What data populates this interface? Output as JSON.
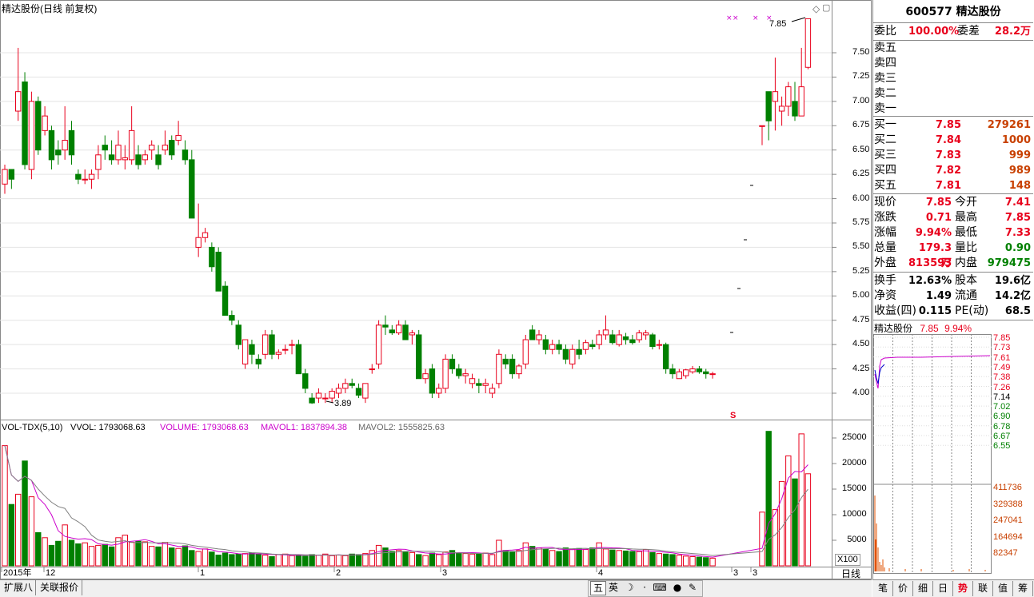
{
  "chart": {
    "title": "精达股份(日线 前复权)",
    "price_ticks": [
      "7.50",
      "7.25",
      "7.00",
      "6.75",
      "6.50",
      "6.25",
      "6.00",
      "5.75",
      "5.50",
      "5.25",
      "5.00",
      "4.75",
      "4.50",
      "4.25",
      "4.00"
    ],
    "high_label": "7.85",
    "low_label": "3.89",
    "s_marker": "S",
    "vol_title": "VOL-TDX(5,10)",
    "vvol": "VVOL: 1793068.63",
    "volume": "VOLUME: 1793068.63",
    "mavol1": "MAVOL1: 1837894.38",
    "mavol2": "MAVOL2: 1555825.63",
    "vol_ticks": [
      "25000",
      "20000",
      "15000",
      "10000",
      "5000"
    ],
    "vol_unit": "X100",
    "period_label": "日线",
    "x_labels": [
      "2015年",
      "12",
      "1",
      "2",
      "3",
      "3",
      "4",
      "3",
      "3"
    ],
    "colors": {
      "up": "#e8001c",
      "down": "#008000",
      "ma1": "#cc00cc",
      "ma2": "#808080"
    }
  },
  "chart_data": {
    "type": "candlestick",
    "title": "精达股份(日线 前复权)",
    "ylim": [
      3.8,
      7.95
    ],
    "volume_ylim": [
      0,
      27000
    ],
    "candles": [
      [
        6.15,
        6.35,
        6.05,
        6.3
      ],
      [
        6.3,
        6.3,
        6.1,
        6.2
      ],
      [
        6.9,
        7.55,
        6.8,
        7.1
      ],
      [
        7.2,
        7.3,
        6.3,
        6.35
      ],
      [
        6.3,
        7.1,
        6.2,
        7.0
      ],
      [
        7.0,
        7.05,
        6.45,
        6.5
      ],
      [
        6.7,
        6.95,
        6.65,
        6.85
      ],
      [
        6.7,
        6.75,
        6.3,
        6.4
      ],
      [
        6.5,
        6.6,
        6.35,
        6.45
      ],
      [
        6.5,
        6.95,
        6.4,
        6.6
      ],
      [
        6.7,
        6.8,
        6.35,
        6.45
      ],
      [
        6.25,
        6.3,
        6.15,
        6.2
      ],
      [
        6.2,
        6.3,
        6.15,
        6.2
      ],
      [
        6.2,
        6.3,
        6.1,
        6.25
      ],
      [
        6.3,
        6.55,
        6.2,
        6.45
      ],
      [
        6.55,
        6.65,
        6.4,
        6.5
      ],
      [
        6.45,
        6.6,
        6.35,
        6.4
      ],
      [
        6.4,
        6.7,
        6.35,
        6.55
      ],
      [
        6.4,
        6.55,
        6.3,
        6.42
      ],
      [
        6.4,
        6.95,
        6.35,
        6.7
      ],
      [
        6.45,
        6.55,
        6.3,
        6.35
      ],
      [
        6.4,
        6.5,
        6.35,
        6.45
      ],
      [
        6.5,
        6.6,
        6.4,
        6.55
      ],
      [
        6.45,
        6.55,
        6.3,
        6.35
      ],
      [
        6.5,
        6.7,
        6.45,
        6.55
      ],
      [
        6.6,
        6.65,
        6.4,
        6.45
      ],
      [
        6.6,
        6.8,
        6.55,
        6.65
      ],
      [
        6.5,
        6.6,
        6.35,
        6.4
      ],
      [
        6.4,
        6.5,
        5.85,
        5.8
      ],
      [
        5.5,
        5.95,
        5.4,
        5.6
      ],
      [
        5.6,
        5.7,
        5.55,
        5.65
      ],
      [
        5.5,
        5.55,
        5.25,
        5.3
      ],
      [
        5.45,
        5.5,
        5.05,
        5.05
      ],
      [
        5.1,
        5.15,
        4.85,
        4.8
      ],
      [
        4.8,
        4.85,
        4.7,
        4.75
      ],
      [
        4.7,
        4.75,
        4.45,
        4.5
      ],
      [
        4.3,
        4.55,
        4.25,
        4.55
      ],
      [
        4.5,
        4.55,
        4.3,
        4.4
      ],
      [
        4.35,
        4.4,
        4.25,
        4.3
      ],
      [
        4.4,
        4.65,
        4.35,
        4.6
      ],
      [
        4.6,
        4.65,
        4.35,
        4.4
      ],
      [
        4.4,
        4.45,
        4.35,
        4.42
      ],
      [
        4.45,
        4.5,
        4.4,
        4.45
      ],
      [
        4.5,
        4.55,
        4.4,
        4.5
      ],
      [
        4.5,
        4.55,
        4.2,
        4.2
      ],
      [
        4.2,
        4.25,
        4.0,
        4.05
      ],
      [
        3.95,
        4.0,
        3.89,
        3.9
      ],
      [
        3.95,
        4.05,
        3.9,
        4.0
      ],
      [
        3.95,
        4.0,
        3.9,
        3.95
      ],
      [
        3.95,
        4.05,
        3.9,
        4.02
      ],
      [
        4.0,
        4.1,
        3.95,
        4.05
      ],
      [
        4.05,
        4.15,
        4.0,
        4.1
      ],
      [
        4.1,
        4.15,
        4.05,
        4.08
      ],
      [
        4.05,
        4.1,
        3.95,
        3.98
      ],
      [
        3.95,
        4.1,
        3.9,
        4.1
      ],
      [
        4.25,
        4.3,
        4.2,
        4.25
      ],
      [
        4.3,
        4.75,
        4.25,
        4.7
      ],
      [
        4.7,
        4.8,
        4.6,
        4.68
      ],
      [
        4.65,
        4.7,
        4.6,
        4.62
      ],
      [
        4.62,
        4.75,
        4.6,
        4.7
      ],
      [
        4.7,
        4.75,
        4.55,
        4.55
      ],
      [
        4.6,
        4.65,
        4.5,
        4.62
      ],
      [
        4.6,
        4.65,
        4.15,
        4.15
      ],
      [
        4.15,
        4.25,
        4.1,
        4.2
      ],
      [
        4.25,
        4.3,
        3.95,
        4.0
      ],
      [
        4.0,
        4.1,
        3.95,
        4.05
      ],
      [
        4.05,
        4.4,
        4.0,
        4.35
      ],
      [
        4.35,
        4.4,
        4.2,
        4.25
      ],
      [
        4.25,
        4.3,
        4.15,
        4.18
      ],
      [
        4.18,
        4.25,
        4.1,
        4.2
      ],
      [
        4.1,
        4.2,
        4.05,
        4.15
      ],
      [
        4.1,
        4.15,
        4.0,
        4.08
      ],
      [
        4.08,
        4.15,
        4.0,
        4.1
      ],
      [
        4.0,
        4.1,
        3.95,
        4.05
      ],
      [
        4.1,
        4.45,
        4.05,
        4.4
      ],
      [
        4.35,
        4.4,
        4.25,
        4.3
      ],
      [
        4.35,
        4.4,
        4.15,
        4.2
      ],
      [
        4.2,
        4.3,
        4.15,
        4.28
      ],
      [
        4.3,
        4.6,
        4.25,
        4.55
      ],
      [
        4.65,
        4.7,
        4.55,
        4.55
      ],
      [
        4.55,
        4.65,
        4.5,
        4.6
      ],
      [
        4.55,
        4.6,
        4.4,
        4.45
      ],
      [
        4.45,
        4.55,
        4.4,
        4.5
      ],
      [
        4.5,
        4.55,
        4.4,
        4.45
      ],
      [
        4.45,
        4.5,
        4.3,
        4.35
      ],
      [
        4.3,
        4.5,
        4.25,
        4.45
      ],
      [
        4.45,
        4.55,
        4.35,
        4.4
      ],
      [
        4.45,
        4.55,
        4.4,
        4.52
      ],
      [
        4.5,
        4.55,
        4.45,
        4.48
      ],
      [
        4.5,
        4.65,
        4.45,
        4.6
      ],
      [
        4.6,
        4.8,
        4.55,
        4.65
      ],
      [
        4.6,
        4.65,
        4.5,
        4.52
      ],
      [
        4.5,
        4.65,
        4.48,
        4.6
      ],
      [
        4.58,
        4.62,
        4.5,
        4.55
      ],
      [
        4.55,
        4.6,
        4.5,
        4.52
      ],
      [
        4.55,
        4.65,
        4.52,
        4.62
      ],
      [
        4.6,
        4.65,
        4.55,
        4.62
      ],
      [
        4.6,
        4.62,
        4.45,
        4.48
      ],
      [
        4.5,
        4.55,
        4.45,
        4.5
      ],
      [
        4.5,
        4.52,
        4.2,
        4.25
      ],
      [
        4.25,
        4.3,
        4.15,
        4.2
      ],
      [
        4.15,
        4.25,
        4.15,
        4.22
      ],
      [
        4.18,
        4.25,
        4.15,
        4.24
      ],
      [
        4.22,
        4.28,
        4.2,
        4.25
      ],
      [
        4.25,
        4.28,
        4.2,
        4.22
      ],
      [
        4.22,
        4.25,
        4.15,
        4.2
      ],
      [
        4.2,
        4.22,
        4.15,
        4.2
      ],
      [
        6.75,
        6.75,
        6.55,
        6.75
      ],
      [
        7.1,
        7.1,
        6.6,
        6.8
      ],
      [
        7.0,
        7.45,
        6.7,
        7.1
      ],
      [
        6.9,
        7.05,
        6.75,
        6.95
      ],
      [
        6.95,
        7.2,
        6.85,
        7.15
      ],
      [
        7.0,
        7.2,
        6.8,
        6.85
      ],
      [
        6.85,
        7.55,
        6.85,
        7.15
      ],
      [
        7.35,
        7.85,
        7.33,
        7.85
      ]
    ],
    "volumes": [
      23500,
      12000,
      14000,
      20500,
      13500,
      6500,
      5500,
      4000,
      4800,
      8000,
      5000,
      4300,
      4500,
      3800,
      4000,
      4200,
      3700,
      5500,
      6000,
      4600,
      4800,
      4700,
      3800,
      3700,
      4600,
      3500,
      3400,
      3900,
      3000,
      2800,
      3300,
      2700,
      2100,
      2500,
      2200,
      2300,
      2400,
      2500,
      2300,
      2100,
      1800,
      2200,
      2300,
      2000,
      2100,
      1900,
      2200,
      2100,
      2300,
      2000,
      2100,
      2000,
      2300,
      2200,
      2400,
      3000,
      4000,
      3500,
      2800,
      3000,
      2800,
      2600,
      2200,
      2000,
      2500,
      2200,
      2700,
      3000,
      2500,
      2400,
      2300,
      2400,
      2500,
      2200,
      5000,
      3000,
      2800,
      3000,
      4500,
      3800,
      3500,
      3200,
      3000,
      2800,
      3500,
      3300,
      3400,
      3200,
      3500,
      4500,
      3300,
      3100,
      3000,
      2900,
      2800,
      2800,
      3200,
      2600,
      2400,
      2300,
      2200,
      2100,
      1900,
      1800,
      1700,
      1600,
      1500,
      10500,
      26300,
      11000,
      16500,
      21500,
      17000,
      25800,
      18000
    ],
    "ma5_label": "MAVOL1: 1837894.38",
    "ma10_label": "MAVOL2: 1555825.63"
  },
  "quote": {
    "code_name": "600577  精达股份",
    "weibi_label": "委比",
    "weibi_value": "100.00%",
    "weicha_label": "委差",
    "weicha_value": "28.2万",
    "sells": [
      "卖五",
      "卖四",
      "卖三",
      "卖二",
      "卖一"
    ],
    "buys": [
      {
        "label": "买一",
        "price": "7.85",
        "vol": "279261"
      },
      {
        "label": "买二",
        "price": "7.84",
        "vol": "1000"
      },
      {
        "label": "买三",
        "price": "7.83",
        "vol": "999"
      },
      {
        "label": "买四",
        "price": "7.82",
        "vol": "989"
      },
      {
        "label": "买五",
        "price": "7.81",
        "vol": "148"
      }
    ],
    "stats": [
      {
        "l1": "现价",
        "v1": "7.85",
        "l2": "今开",
        "v2": "7.41",
        "c1": "red",
        "c2": "red"
      },
      {
        "l1": "涨跌",
        "v1": "0.71",
        "l2": "最高",
        "v2": "7.85",
        "c1": "red",
        "c2": "red"
      },
      {
        "l1": "涨幅",
        "v1": "9.94%",
        "l2": "最低",
        "v2": "7.33",
        "c1": "red",
        "c2": "red"
      },
      {
        "l1": "总量",
        "v1": "179.3万",
        "l2": "量比",
        "v2": "0.90",
        "c1": "red",
        "c2": "green"
      },
      {
        "l1": "外盘",
        "v1": "813593",
        "l2": "内盘",
        "v2": "979475",
        "c1": "red",
        "c2": "green"
      }
    ],
    "fund": [
      {
        "l1": "换手",
        "v1": "12.63%",
        "l2": "股本",
        "v2": "19.6亿"
      },
      {
        "l1": "净资",
        "v1": "1.49",
        "l2": "流通",
        "v2": "14.2亿"
      },
      {
        "l1": "收益(四)",
        "v1": "0.115",
        "l2": "PE(动)",
        "v2": "68.5"
      }
    ]
  },
  "mini": {
    "title": "精达股份",
    "price": "7.85",
    "pct": "9.94%",
    "price_ticks": [
      {
        "v": "7.85",
        "c": "red"
      },
      {
        "v": "7.73",
        "c": "red"
      },
      {
        "v": "7.61",
        "c": "red"
      },
      {
        "v": "7.49",
        "c": "red"
      },
      {
        "v": "7.38",
        "c": "red"
      },
      {
        "v": "7.26",
        "c": "red"
      },
      {
        "v": "7.14",
        "c": "black"
      },
      {
        "v": "7.02",
        "c": "green"
      },
      {
        "v": "6.90",
        "c": "green"
      },
      {
        "v": "6.78",
        "c": "green"
      },
      {
        "v": "6.67",
        "c": "green"
      },
      {
        "v": "6.55",
        "c": "green"
      }
    ],
    "vol_ticks": [
      "411736",
      "329388",
      "247041",
      "164694",
      "82347"
    ]
  },
  "bottom": {
    "tabs_left": [
      "扩展八",
      "关联报价"
    ],
    "tabs_right": [
      "笔",
      "价",
      "细",
      "日",
      "势",
      "联",
      "值",
      "筹"
    ],
    "ime": [
      "五",
      "英"
    ]
  }
}
